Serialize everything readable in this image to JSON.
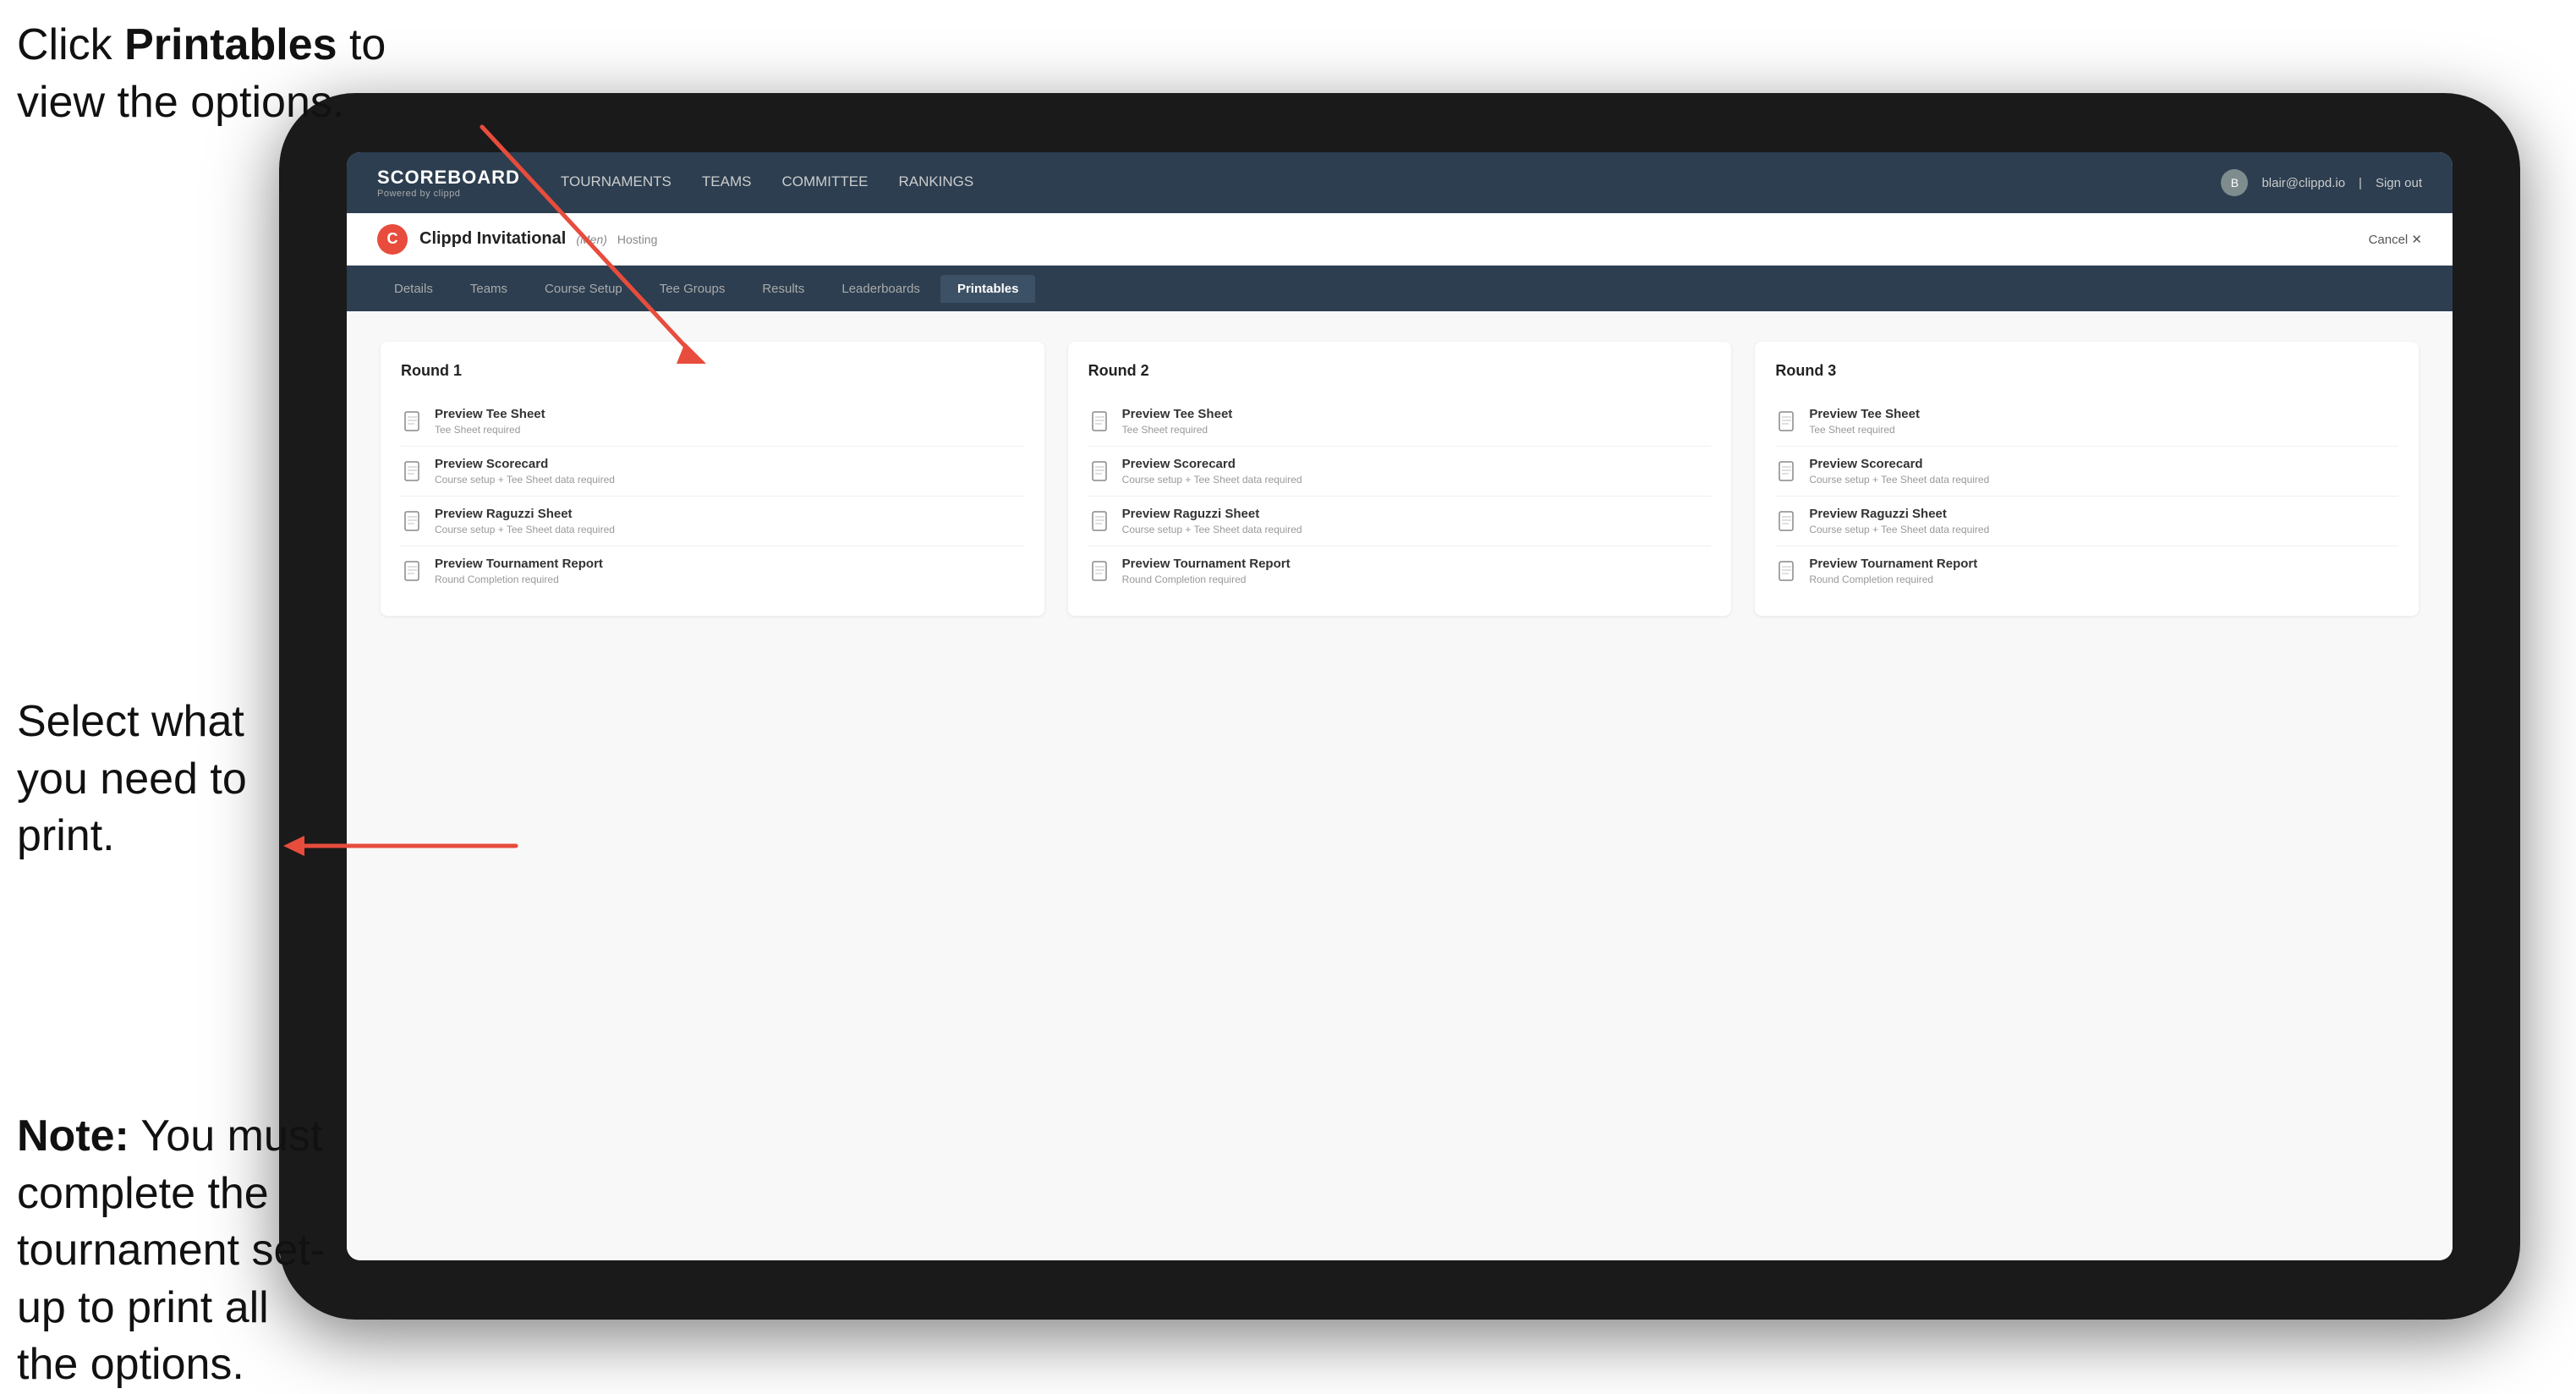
{
  "annotations": {
    "top_text_line1": "Click ",
    "top_bold": "Printables",
    "top_text_line2": " to",
    "top_text_line3": "view the options.",
    "middle_text": "Select what you need to print.",
    "bottom_bold": "Note:",
    "bottom_text": " You must complete the tournament set-up to print all the options."
  },
  "nav": {
    "logo_title": "SCOREBOARD",
    "logo_sub": "Powered by clippd",
    "links": [
      {
        "label": "TOURNAMENTS",
        "active": false
      },
      {
        "label": "TEAMS",
        "active": false
      },
      {
        "label": "COMMITTEE",
        "active": false
      },
      {
        "label": "RANKINGS",
        "active": false
      }
    ],
    "user_email": "blair@clippd.io",
    "sign_out": "Sign out"
  },
  "tournament": {
    "logo_letter": "C",
    "name": "Clippd Invitational",
    "badge": "(Men)",
    "status": "Hosting",
    "cancel": "Cancel ✕"
  },
  "tabs": [
    {
      "label": "Details",
      "active": false
    },
    {
      "label": "Teams",
      "active": false
    },
    {
      "label": "Course Setup",
      "active": false
    },
    {
      "label": "Tee Groups",
      "active": false
    },
    {
      "label": "Results",
      "active": false
    },
    {
      "label": "Leaderboards",
      "active": false
    },
    {
      "label": "Printables",
      "active": true
    }
  ],
  "rounds": [
    {
      "title": "Round 1",
      "items": [
        {
          "title": "Preview Tee Sheet",
          "subtitle": "Tee Sheet required"
        },
        {
          "title": "Preview Scorecard",
          "subtitle": "Course setup + Tee Sheet data required"
        },
        {
          "title": "Preview Raguzzi Sheet",
          "subtitle": "Course setup + Tee Sheet data required"
        },
        {
          "title": "Preview Tournament Report",
          "subtitle": "Round Completion required"
        }
      ]
    },
    {
      "title": "Round 2",
      "items": [
        {
          "title": "Preview Tee Sheet",
          "subtitle": "Tee Sheet required"
        },
        {
          "title": "Preview Scorecard",
          "subtitle": "Course setup + Tee Sheet data required"
        },
        {
          "title": "Preview Raguzzi Sheet",
          "subtitle": "Course setup + Tee Sheet data required"
        },
        {
          "title": "Preview Tournament Report",
          "subtitle": "Round Completion required"
        }
      ]
    },
    {
      "title": "Round 3",
      "items": [
        {
          "title": "Preview Tee Sheet",
          "subtitle": "Tee Sheet required"
        },
        {
          "title": "Preview Scorecard",
          "subtitle": "Course setup + Tee Sheet data required"
        },
        {
          "title": "Preview Raguzzi Sheet",
          "subtitle": "Course setup + Tee Sheet data required"
        },
        {
          "title": "Preview Tournament Report",
          "subtitle": "Round Completion required"
        }
      ]
    }
  ]
}
